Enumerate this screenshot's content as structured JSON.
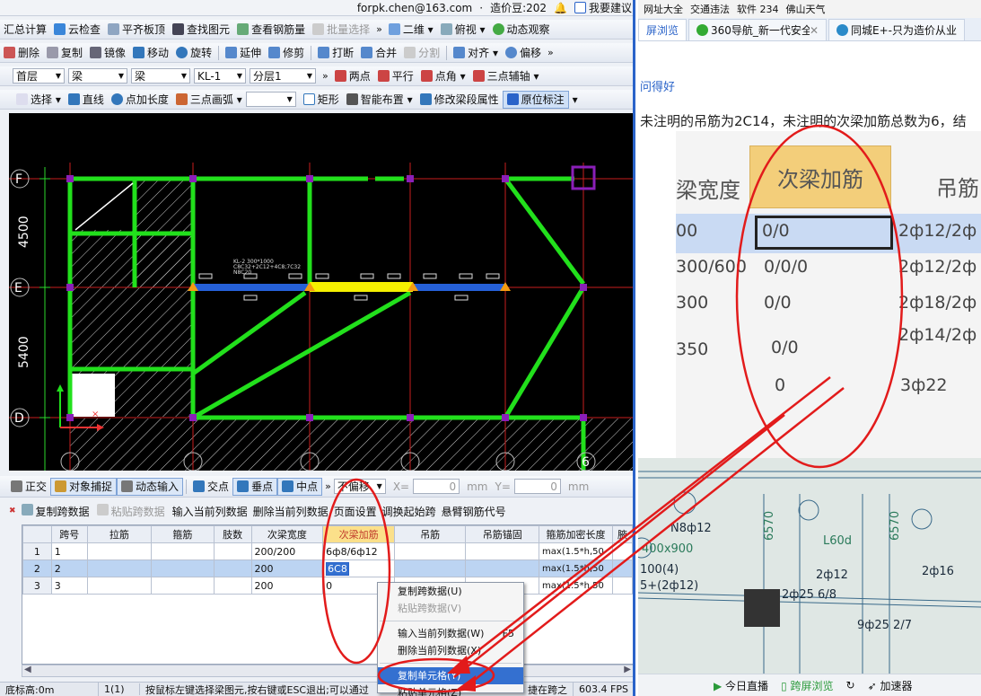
{
  "top_strip": {
    "email": "forpk.chen@163.com",
    "separator": "·",
    "balance": "造价豆:202",
    "suggest": "我要建议"
  },
  "toolbar1": {
    "items": [
      "汇总计算",
      "云检查",
      "平齐板顶",
      "查找图元",
      "查看钢筋量",
      "批量选择"
    ],
    "view2d": "二维",
    "view_persp": "俯视",
    "dynamic": "动态观察"
  },
  "toolbar2": {
    "items": [
      "删除",
      "复制",
      "镜像",
      "移动",
      "旋转",
      "延伸",
      "修剪",
      "打断",
      "合并",
      "分割",
      "对齐",
      "偏移"
    ]
  },
  "toolbar3": {
    "floor": "首层",
    "type": "梁",
    "subtype": "梁",
    "name": "KL-1",
    "layer": "分层1",
    "two_point": "两点",
    "parallel": "平行",
    "point_angle": "点角",
    "three_point_aux": "三点辅轴"
  },
  "toolbar4": {
    "select": "选择",
    "line": "直线",
    "point_length": "点加长度",
    "three_arc": "三点画弧",
    "rect": "矩形",
    "smart": "智能布置",
    "modify_span": "修改梁段属性",
    "origin_mark": "原位标注"
  },
  "cad": {
    "axis_rows": [
      "F",
      "E",
      "D"
    ],
    "axis_cols": [
      "6"
    ],
    "dims": [
      "4500",
      "5400"
    ],
    "beam_label_1": "KL-2 300*1000",
    "beam_label_2": "C8C32+2C12+4C8;7C32",
    "beam_label_3": "N8C20"
  },
  "snapbar": {
    "ortho": "正交",
    "snap": "对象捕捉",
    "dyn_input": "动态输入",
    "intersect": "交点",
    "perp": "垂点",
    "mid": "中点",
    "offset_mode": "不偏移",
    "x_label": "X=",
    "x_value": "0",
    "y_label": "Y=",
    "y_value": "0",
    "unit": "mm"
  },
  "tablebar": {
    "copy_span": "复制跨数据",
    "paste_span": "粘贴跨数据",
    "input_col": "输入当前列数据",
    "delete_col": "删除当前列数据",
    "page_setup": "页面设置",
    "swap_start": "调换起始跨",
    "cantilever": "悬臂钢筋代号"
  },
  "table": {
    "headers": [
      "跨号",
      "拉筋",
      "箍筋",
      "肢数",
      "次梁宽度",
      "次梁加筋",
      "吊筋",
      "吊筋锚固",
      "箍筋加密长度",
      "腋"
    ],
    "rows": [
      {
        "no": "1",
        "span": "1",
        "tie": "",
        "stirrup": "",
        "legs": "",
        "width": "200/200",
        "add": "6ф8/6ф12",
        "hang": "",
        "anchor": "",
        "dense": "max(1.5*h,50",
        "yi": ""
      },
      {
        "no": "2",
        "span": "2",
        "tie": "",
        "stirrup": "",
        "legs": "",
        "width": "200",
        "add": "6C8",
        "hang": "",
        "anchor": "",
        "dense": "max(1.5*h,50",
        "yi": ""
      },
      {
        "no": "3",
        "span": "3",
        "tie": "",
        "stirrup": "",
        "legs": "",
        "width": "200",
        "add": "0",
        "hang": "",
        "anchor": "",
        "dense": "max(1.5*h,50",
        "yi": ""
      }
    ]
  },
  "context_menu": {
    "copy_span": "复制跨数据(U)",
    "paste_span": "粘贴跨数据(V)",
    "input_col": "输入当前列数据(W)",
    "input_col_key": "F5",
    "delete_col": "删除当前列数据(X)",
    "copy_cell": "复制单元格(Y)",
    "paste_cell": "粘贴单元格(Z)"
  },
  "statusbar": {
    "height": "底标高:0m",
    "count": "1(1)",
    "hint": "按鼠标左键选择梁图元,按右键或ESC退出;可以通过",
    "cross": "捷在跨之",
    "fps": "603.4 FPS"
  },
  "browser": {
    "bookmarks": [
      "网址大全",
      "交通违法",
      "软件 234",
      "佛山天气"
    ],
    "tabs": [
      "屏浏览",
      "360导航_新一代安全",
      "同城E+-只为造价从业"
    ],
    "question_title": "问得好",
    "question_text": "未注明的吊筋为2C14，未注明的次梁加筋总数为6，结",
    "photo_headers": [
      "梁宽度",
      "次梁加筋",
      "吊筋"
    ],
    "photo_rows": [
      {
        "w": "00",
        "add": "0/0",
        "hang": "2ф12/2ф"
      },
      {
        "w": "300/600",
        "add": "0/0/0",
        "hang": "2ф12/2ф"
      },
      {
        "w": "300",
        "add": "0/0",
        "hang": "2ф18/2ф"
      },
      {
        "w": "350",
        "add": "0/0",
        "hang": "2ф14/2ф"
      },
      {
        "w": "",
        "add": "0",
        "hang": "3ф22"
      }
    ],
    "drawing_labels": [
      "N8ф12",
      "400x900",
      "100(4)",
      "5+(2ф12)",
      "2ф12",
      "2ф16",
      "2ф25 6/8",
      "9ф25 2/7",
      "L60d",
      "6570",
      "6570"
    ],
    "status": [
      "今日直播",
      "跨屏浏览",
      "加速器"
    ]
  },
  "accent": {
    "red": "#e21b1b",
    "blue": "#2a63c9",
    "green": "#22e01c",
    "yellow": "#f5f000"
  }
}
